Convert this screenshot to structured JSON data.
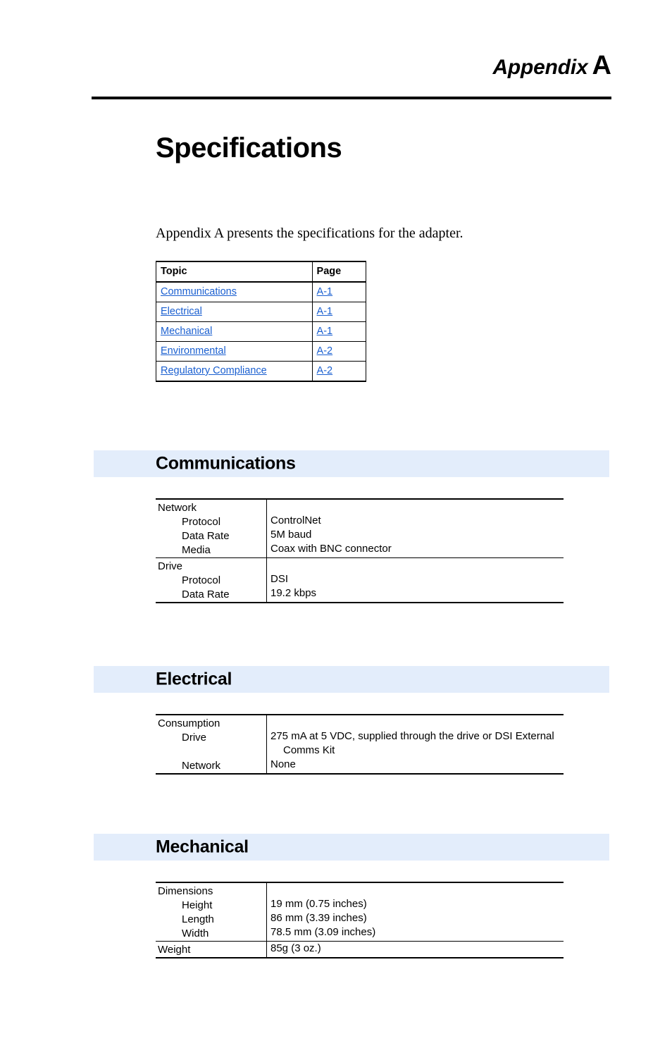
{
  "header": {
    "appendix_word": "Appendix",
    "appendix_letter": "A"
  },
  "page_title": "Specifications",
  "intro": "Appendix A presents the specifications for the adapter.",
  "topic_table": {
    "headers": {
      "topic": "Topic",
      "page": "Page"
    },
    "rows": [
      {
        "topic": "Communications",
        "page": "A-1"
      },
      {
        "topic": "Electrical",
        "page": "A-1"
      },
      {
        "topic": "Mechanical",
        "page": "A-1"
      },
      {
        "topic": "Environmental",
        "page": "A-2"
      },
      {
        "topic": "Regulatory Compliance",
        "page": "A-2"
      }
    ]
  },
  "sections": {
    "communications": {
      "title": "Communications",
      "groups": [
        {
          "name": "Network",
          "items": [
            {
              "label": "Protocol",
              "value": "ControlNet"
            },
            {
              "label": "Data Rate",
              "value": "5M baud"
            },
            {
              "label": "Media",
              "value": "Coax with BNC connector"
            }
          ]
        },
        {
          "name": "Drive",
          "items": [
            {
              "label": "Protocol",
              "value": "DSI"
            },
            {
              "label": "Data Rate",
              "value": "19.2 kbps"
            }
          ]
        }
      ]
    },
    "electrical": {
      "title": "Electrical",
      "groups": [
        {
          "name": "Consumption",
          "items": [
            {
              "label": "Drive",
              "value": "275 mA at 5 VDC, supplied through the drive or DSI External Comms Kit"
            },
            {
              "label": "Network",
              "value": "None"
            }
          ]
        }
      ]
    },
    "mechanical": {
      "title": "Mechanical",
      "groups": [
        {
          "name": "Dimensions",
          "items": [
            {
              "label": "Height",
              "value": "19 mm (0.75 inches)"
            },
            {
              "label": "Length",
              "value": "86 mm (3.39 inches)"
            },
            {
              "label": "Width",
              "value": "78.5 mm (3.09 inches)"
            }
          ]
        },
        {
          "name": "Weight",
          "items": [
            {
              "label": "",
              "value": "85g (3 oz.)"
            }
          ]
        }
      ]
    }
  },
  "colors": {
    "link": "#1a5fd0",
    "section_bar": "#e3edfb",
    "rule": "#000000"
  }
}
